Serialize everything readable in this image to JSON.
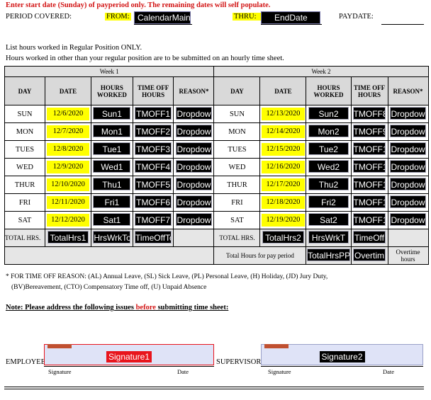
{
  "header": {
    "instruction": "Enter start date (Sunday) of payperiod only.  The remaining dates will self populate.",
    "period_label": "PERIOD COVERED:",
    "from_label": "FROM:",
    "from_field": "CalendarMain",
    "thru_label": "THRU:",
    "thru_field": "EndDate",
    "paydate_label": "PAYDATE:"
  },
  "instructions": {
    "line1": "List hours worked in Regular Position ONLY.",
    "line2": "Hours worked in other than your regular position are to be submitted on an hourly time sheet."
  },
  "table": {
    "week1_title": "Week 1",
    "week2_title": "Week 2",
    "col_day": "DAY",
    "col_date": "DATE",
    "col_hours": "HOURS WORKED",
    "col_timeoff": "TIME OFF HOURS",
    "col_reason": "REASON*",
    "week1": [
      {
        "day": "SUN",
        "date": "12/6/2020",
        "hours": "Sun1",
        "timeoff": "TMOFF1",
        "reason": "Dropdow"
      },
      {
        "day": "MON",
        "date": "12/7/2020",
        "hours": "Mon1",
        "timeoff": "TMOFF2",
        "reason": "Dropdow"
      },
      {
        "day": "TUES",
        "date": "12/8/2020",
        "hours": "Tue1",
        "timeoff": "TMOFF3",
        "reason": "Dropdow"
      },
      {
        "day": "WED",
        "date": "12/9/2020",
        "hours": "Wed1",
        "timeoff": "TMOFF4",
        "reason": "Dropdow"
      },
      {
        "day": "THUR",
        "date": "12/10/2020",
        "hours": "Thu1",
        "timeoff": "TMOFF5",
        "reason": "Dropdow"
      },
      {
        "day": "FRI",
        "date": "12/11/2020",
        "hours": "Fri1",
        "timeoff": "TMOFF6",
        "reason": "Dropdow"
      },
      {
        "day": "SAT",
        "date": "12/12/2020",
        "hours": "Sat1",
        "timeoff": "TMOFF7",
        "reason": "Dropdow"
      }
    ],
    "week2": [
      {
        "day": "SUN",
        "date": "12/13/2020",
        "hours": "Sun2",
        "timeoff": "TMOFF8",
        "reason": "Dropdow"
      },
      {
        "day": "MON",
        "date": "12/14/2020",
        "hours": "Mon2",
        "timeoff": "TMOFF9",
        "reason": "Dropdow"
      },
      {
        "day": "TUES",
        "date": "12/15/2020",
        "hours": "Tue2",
        "timeoff": "TMOFF1",
        "reason": "Dropdow"
      },
      {
        "day": "WED",
        "date": "12/16/2020",
        "hours": "Wed2",
        "timeoff": "TMOFF1",
        "reason": "Dropdow"
      },
      {
        "day": "THUR",
        "date": "12/17/2020",
        "hours": "Thu2",
        "timeoff": "TMOFF1",
        "reason": "Dropdow"
      },
      {
        "day": "FRI",
        "date": "12/18/2020",
        "hours": "Fri2",
        "timeoff": "TMOFF1",
        "reason": "Dropdow"
      },
      {
        "day": "SAT",
        "date": "12/19/2020",
        "hours": "Sat2",
        "timeoff": "TMOFF1",
        "reason": "Dropdow"
      }
    ],
    "total_label1": "TOTAL HRS.",
    "total_hrs1": "TotalHrs1",
    "hrs_wrk_tot1": "HrsWrkTot",
    "timeoff_tot1": "TimeOffTo",
    "total_label2": "TOTAL HRS.",
    "total_hrs2": "TotalHrs2",
    "hrs_wrk_tot2": "HrsWrkT",
    "timeoff_tot2": "TimeOff",
    "pay_period_label": "Total Hours for pay period",
    "total_pp": "TotalHrsPP",
    "overtime_field": "Overtim",
    "overtime_label": "Overtime hours"
  },
  "footnote": {
    "line1": "*  FOR TIME OFF REASON:  (AL) Annual Leave, (SL) Sick Leave, (PL) Personal Leave, (H) Holiday, (JD) Jury Duty,",
    "line2": "(BV)Bereavement, (CTO) Compensatory Time off, (U) Unpaid Absence"
  },
  "note": {
    "prefix": "Note: Please address the following issues ",
    "emphasis": "before",
    "suffix": " submitting time sheet:"
  },
  "signatures": {
    "employee_label": "EMPLOYEE:",
    "employee_field": "Signature1",
    "supervisor_label": "SUPERVISOR:",
    "supervisor_field": "Signature2",
    "signature_caption": "Signature",
    "date_caption": "Date"
  },
  "colors": {
    "highlight": "#ffff00",
    "field_fill": "#dfe3f7",
    "instruction_red": "#d21414",
    "signature_red": "#e8141c"
  }
}
